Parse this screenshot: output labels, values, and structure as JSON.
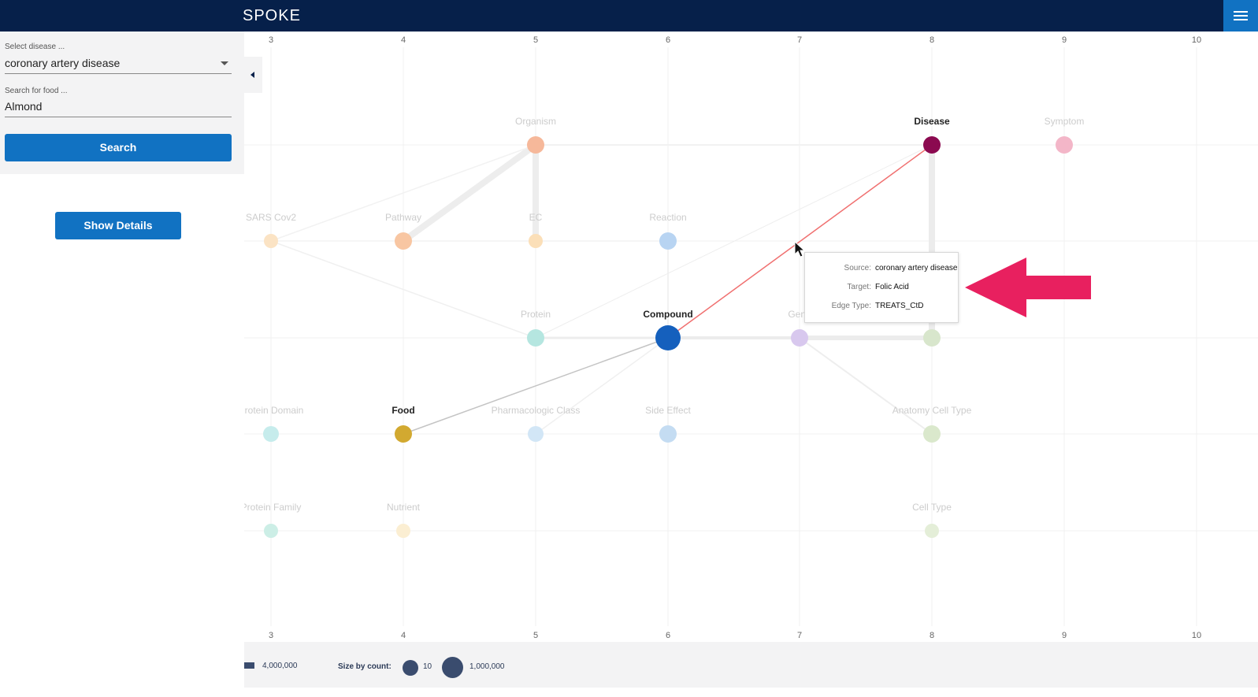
{
  "app": {
    "logo_text": "SPOKE"
  },
  "icons": {
    "menu": "hamburger-menu-icon",
    "dropdown": "caret-down-icon",
    "collapse": "caret-left-icon",
    "cursor": "mouse-pointer-icon",
    "annotation": "arrow-left-icon"
  },
  "colors": {
    "topbar": "#06204a",
    "accent": "#1172c2",
    "annotation": "#e8205f",
    "highlight_edge": "#f07070",
    "disease": "#8b0a50",
    "compound": "#1560bd",
    "food": "#d2a930"
  },
  "sidebar": {
    "disease_label": "Select disease ...",
    "disease_value": "coronary artery disease",
    "food_label": "Search for food ...",
    "food_value": "Almond",
    "search_button": "Search",
    "details_button": "Show Details"
  },
  "graph": {
    "column_ticks": [
      "3",
      "4",
      "5",
      "6",
      "7",
      "8",
      "9",
      "10"
    ],
    "nodes": [
      {
        "label": "Organism",
        "color": "#f6b89a",
        "active": false
      },
      {
        "label": "Disease",
        "color": "#8b0a50",
        "active": true
      },
      {
        "label": "Symptom",
        "color": "#f3b6c8",
        "active": false
      },
      {
        "label": "SARS Cov2",
        "color": "#fbe3c4",
        "active": false
      },
      {
        "label": "Pathway",
        "color": "#f8c6a2",
        "active": false
      },
      {
        "label": "EC",
        "color": "#fbdfb8",
        "active": false
      },
      {
        "label": "Reaction",
        "color": "#b8d4f2",
        "active": false
      },
      {
        "label": "Protein",
        "color": "#b5e6e0",
        "active": false
      },
      {
        "label": "Compound",
        "color": "#1560bd",
        "active": true
      },
      {
        "label": "Gene",
        "color": "#d8c8ee",
        "active": false
      },
      {
        "label": "",
        "color": "#d8e6cc",
        "active": false
      },
      {
        "label": "Protein Domain",
        "color": "#c6ecec",
        "active": false
      },
      {
        "label": "Food",
        "color": "#d2a930",
        "active": true
      },
      {
        "label": "Pharmacologic Class",
        "color": "#d2e6f6",
        "active": false
      },
      {
        "label": "Side Effect",
        "color": "#c4dcf2",
        "active": false
      },
      {
        "label": "Anatomy Cell Type",
        "color": "#dae8cc",
        "active": false
      },
      {
        "label": "Protein Family",
        "color": "#cceee6",
        "active": false
      },
      {
        "label": "Nutrient",
        "color": "#fbeed2",
        "active": false
      },
      {
        "label": "Cell Type",
        "color": "#e4eed8",
        "active": false
      }
    ]
  },
  "tooltip": {
    "source_key": "Source:",
    "source_value": "coronary artery disease",
    "target_key": "Target:",
    "target_value": "Folic Acid",
    "edge_type_key": "Edge Type:",
    "edge_type_value": "TREATS_CtD"
  },
  "legend": {
    "edge_count_label": "4,000,000",
    "size_by_label": "Size by count:",
    "small_label": "10",
    "large_label": "1,000,000"
  }
}
